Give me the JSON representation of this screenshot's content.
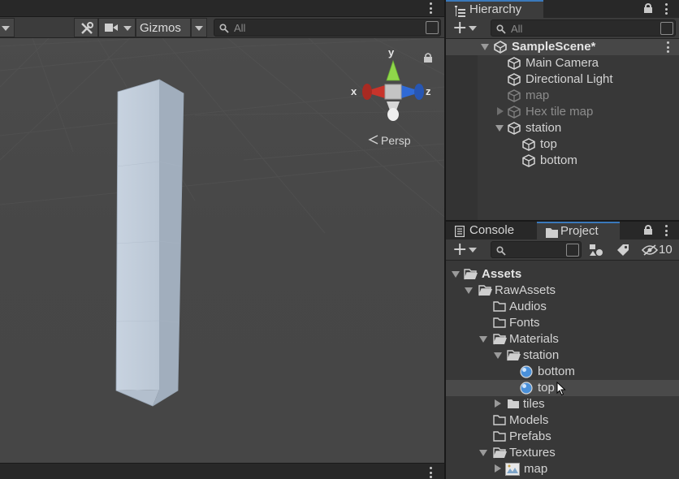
{
  "scene_view": {
    "toolbar": {
      "gizmos_label": "Gizmos",
      "search_placeholder": "All"
    },
    "orientation_gizmo": {
      "y_label": "y",
      "x_label": "x",
      "z_label": "z",
      "projection_label": "Persp"
    }
  },
  "hierarchy": {
    "tab_label": "Hierarchy",
    "search_placeholder": "All",
    "items": [
      {
        "label": "SampleScene*"
      },
      {
        "label": "Main Camera"
      },
      {
        "label": "Directional Light"
      },
      {
        "label": "map"
      },
      {
        "label": "Hex tile map"
      },
      {
        "label": "station"
      },
      {
        "label": "top"
      },
      {
        "label": "bottom"
      }
    ]
  },
  "bottom_panel": {
    "tabs": [
      {
        "label": "Console"
      },
      {
        "label": "Project"
      }
    ],
    "hidden_count": "10",
    "tree": [
      {
        "label": "Assets"
      },
      {
        "label": "RawAssets"
      },
      {
        "label": "Audios"
      },
      {
        "label": "Fonts"
      },
      {
        "label": "Materials"
      },
      {
        "label": "station"
      },
      {
        "label": "bottom"
      },
      {
        "label": "top"
      },
      {
        "label": "tiles"
      },
      {
        "label": "Models"
      },
      {
        "label": "Prefabs"
      },
      {
        "label": "Textures"
      },
      {
        "label": "map"
      }
    ]
  },
  "colors": {
    "accent": "#3a79bb",
    "axis_x": "#c8342b",
    "axis_y": "#8fd64a",
    "axis_z": "#2f6ad6"
  }
}
